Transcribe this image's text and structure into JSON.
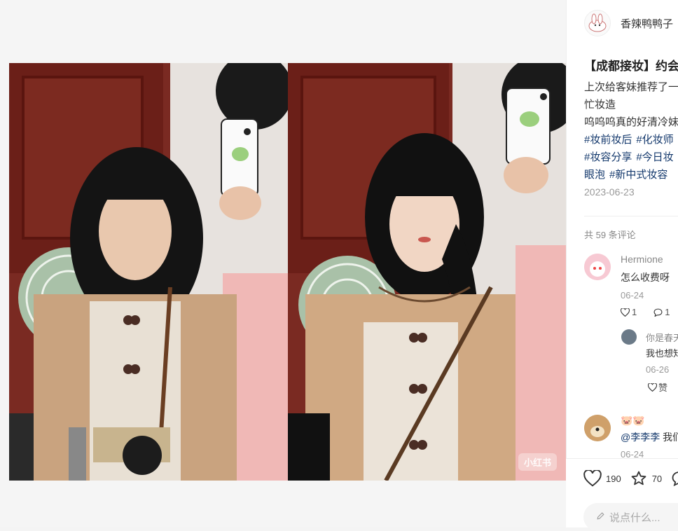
{
  "author": {
    "name": "香辣鸭鸭子"
  },
  "post": {
    "title": "【成都接妆】约会",
    "body_lines": [
      "上次给客妹推荐了一",
      "忙妆造",
      "呜呜呜真的好清冷妹"
    ],
    "tags_line1": [
      "#妆前妆后",
      "#化妆师"
    ],
    "tags_line2": [
      "#妆容分享",
      "#今日妆"
    ],
    "tags_line3": [
      "眼泡",
      "#新中式妆容"
    ],
    "date": "2023-06-23"
  },
  "media": {
    "watermark": "小红书"
  },
  "comments": {
    "count_label": "共 59 条评论",
    "items": [
      {
        "name": "Hermione",
        "text": "怎么收费呀",
        "date": "06-24",
        "likes": "1",
        "replies": "1"
      },
      {
        "name": "你是春天",
        "text": "我也想知",
        "date": "06-26",
        "like_label": "赞"
      },
      {
        "name": "🐷🐷",
        "mention": "@李李李",
        "text": "我们",
        "date": "06-24"
      }
    ]
  },
  "engagement": {
    "likes": "190",
    "collects": "70"
  },
  "input": {
    "placeholder": "说点什么..."
  },
  "colors": {
    "tag": "#13386c",
    "like_red": "#ff2442"
  }
}
